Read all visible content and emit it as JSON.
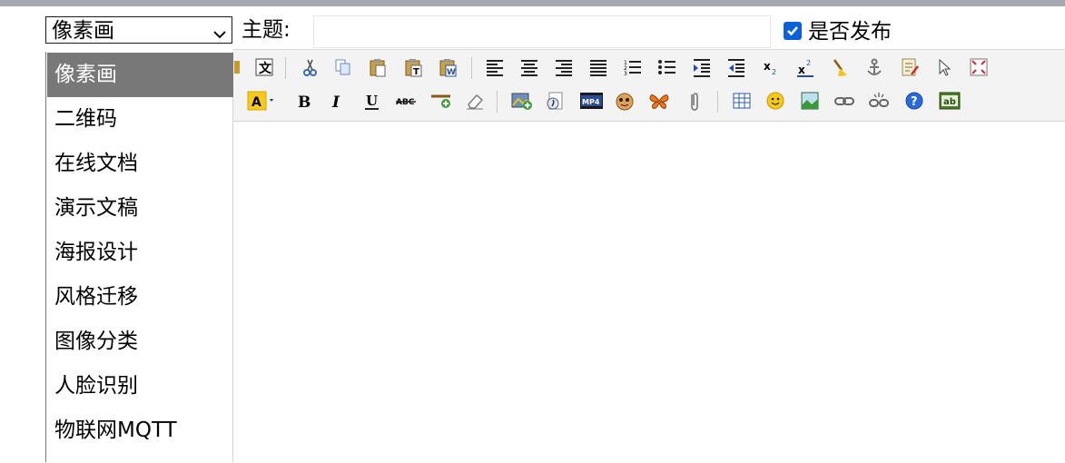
{
  "category_select": {
    "value": "像素画",
    "options": [
      "像素画",
      "二维码",
      "在线文档",
      "演示文稿",
      "海报设计",
      "风格迁移",
      "图像分类",
      "人脸识别",
      "物联网MQTT"
    ]
  },
  "subject": {
    "label": "主题:",
    "value": ""
  },
  "publish": {
    "label": "是否发布",
    "checked": true
  },
  "colors": {
    "accent": "#0b62d8",
    "selected_option_bg": "#787878",
    "toolbar_bg": "#f3f3f3"
  },
  "toolbar": {
    "row1_icons": [
      "paste-word-icon",
      "paste-text-icon",
      "cut-icon",
      "copy-icon",
      "paste-icon",
      "paste-plain-icon",
      "paste-from-word-icon",
      "align-left-icon",
      "align-center-icon",
      "align-right-icon",
      "align-justify-icon",
      "ordered-list-icon",
      "unordered-list-icon",
      "indent-icon",
      "outdent-icon",
      "subscript-icon",
      "superscript-icon",
      "clear-format-icon",
      "anchor-icon",
      "edit-source-icon",
      "select-all-icon",
      "fullscreen-icon"
    ],
    "row2_icons": [
      "highlight-color-icon",
      "bold-icon",
      "italic-icon",
      "underline-icon",
      "strikethrough-icon",
      "insert-line-icon",
      "eraser-icon",
      "insert-image-icon",
      "flash-icon",
      "media-mp4-icon",
      "emoticon-cat-icon",
      "butterfly-icon",
      "attachment-icon",
      "table-icon",
      "smiley-icon",
      "image-gallery-icon",
      "link-icon",
      "unlink-icon",
      "help-icon",
      "code-icon"
    ]
  }
}
